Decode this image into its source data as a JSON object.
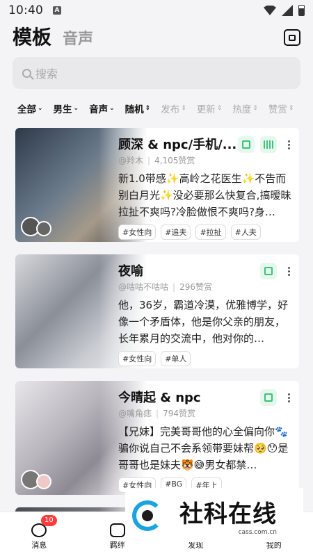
{
  "status": {
    "time": "10:40",
    "sim": "A"
  },
  "header": {
    "tab_active": "模板",
    "tab_inactive": "音声"
  },
  "search": {
    "placeholder": "搜索"
  },
  "filters": [
    {
      "label": "全部",
      "active": true
    },
    {
      "label": "男生",
      "active": true
    },
    {
      "label": "音声",
      "active": true
    },
    {
      "label": "随机",
      "active": true
    },
    {
      "label": "发布",
      "active": false
    },
    {
      "label": "更新",
      "active": false
    },
    {
      "label": "热度",
      "active": false
    },
    {
      "label": "赞赏",
      "active": false
    }
  ],
  "cards": [
    {
      "title": "顾深 & npc/手机/...",
      "author": "@羚木",
      "likes": "4,105赞赏",
      "desc": "新1.0带感✨高岭之花医生✨不告而别白月光✨没必要那么快复合,搞暧昧拉扯不爽吗?冷脸做恨不爽吗?身…",
      "tags": [
        "#女性向",
        "#追夫",
        "#拉扯",
        "#人夫"
      ]
    },
    {
      "title": "夜喻",
      "author": "@咕咕不咕咕",
      "likes": "296赞赏",
      "desc": "他，36岁，霸道冷漠，优雅博学，好像一个矛盾体，他是你父亲的朋友，长年累月的交流中，他对你的…",
      "tags": [
        "#女性向",
        "#单人"
      ]
    },
    {
      "title": "今晴起 & npc",
      "author": "@嘴角痣",
      "likes": "794赞赏",
      "desc": "【兄妹】完美哥哥他的心全偏向你🐾骗你说自己不会系领带要妹帮🥺😯是哥哥也是妹夫🐯😅男女都禁…",
      "tags": [
        "#女性向",
        "#BG",
        "#年上"
      ]
    }
  ],
  "nav": [
    {
      "label": "消息",
      "badge": "10"
    },
    {
      "label": "羁绊"
    },
    {
      "label": "发现"
    },
    {
      "label": "我的"
    }
  ],
  "watermark": {
    "name": "社科在线",
    "url": "cass.com.cn"
  }
}
